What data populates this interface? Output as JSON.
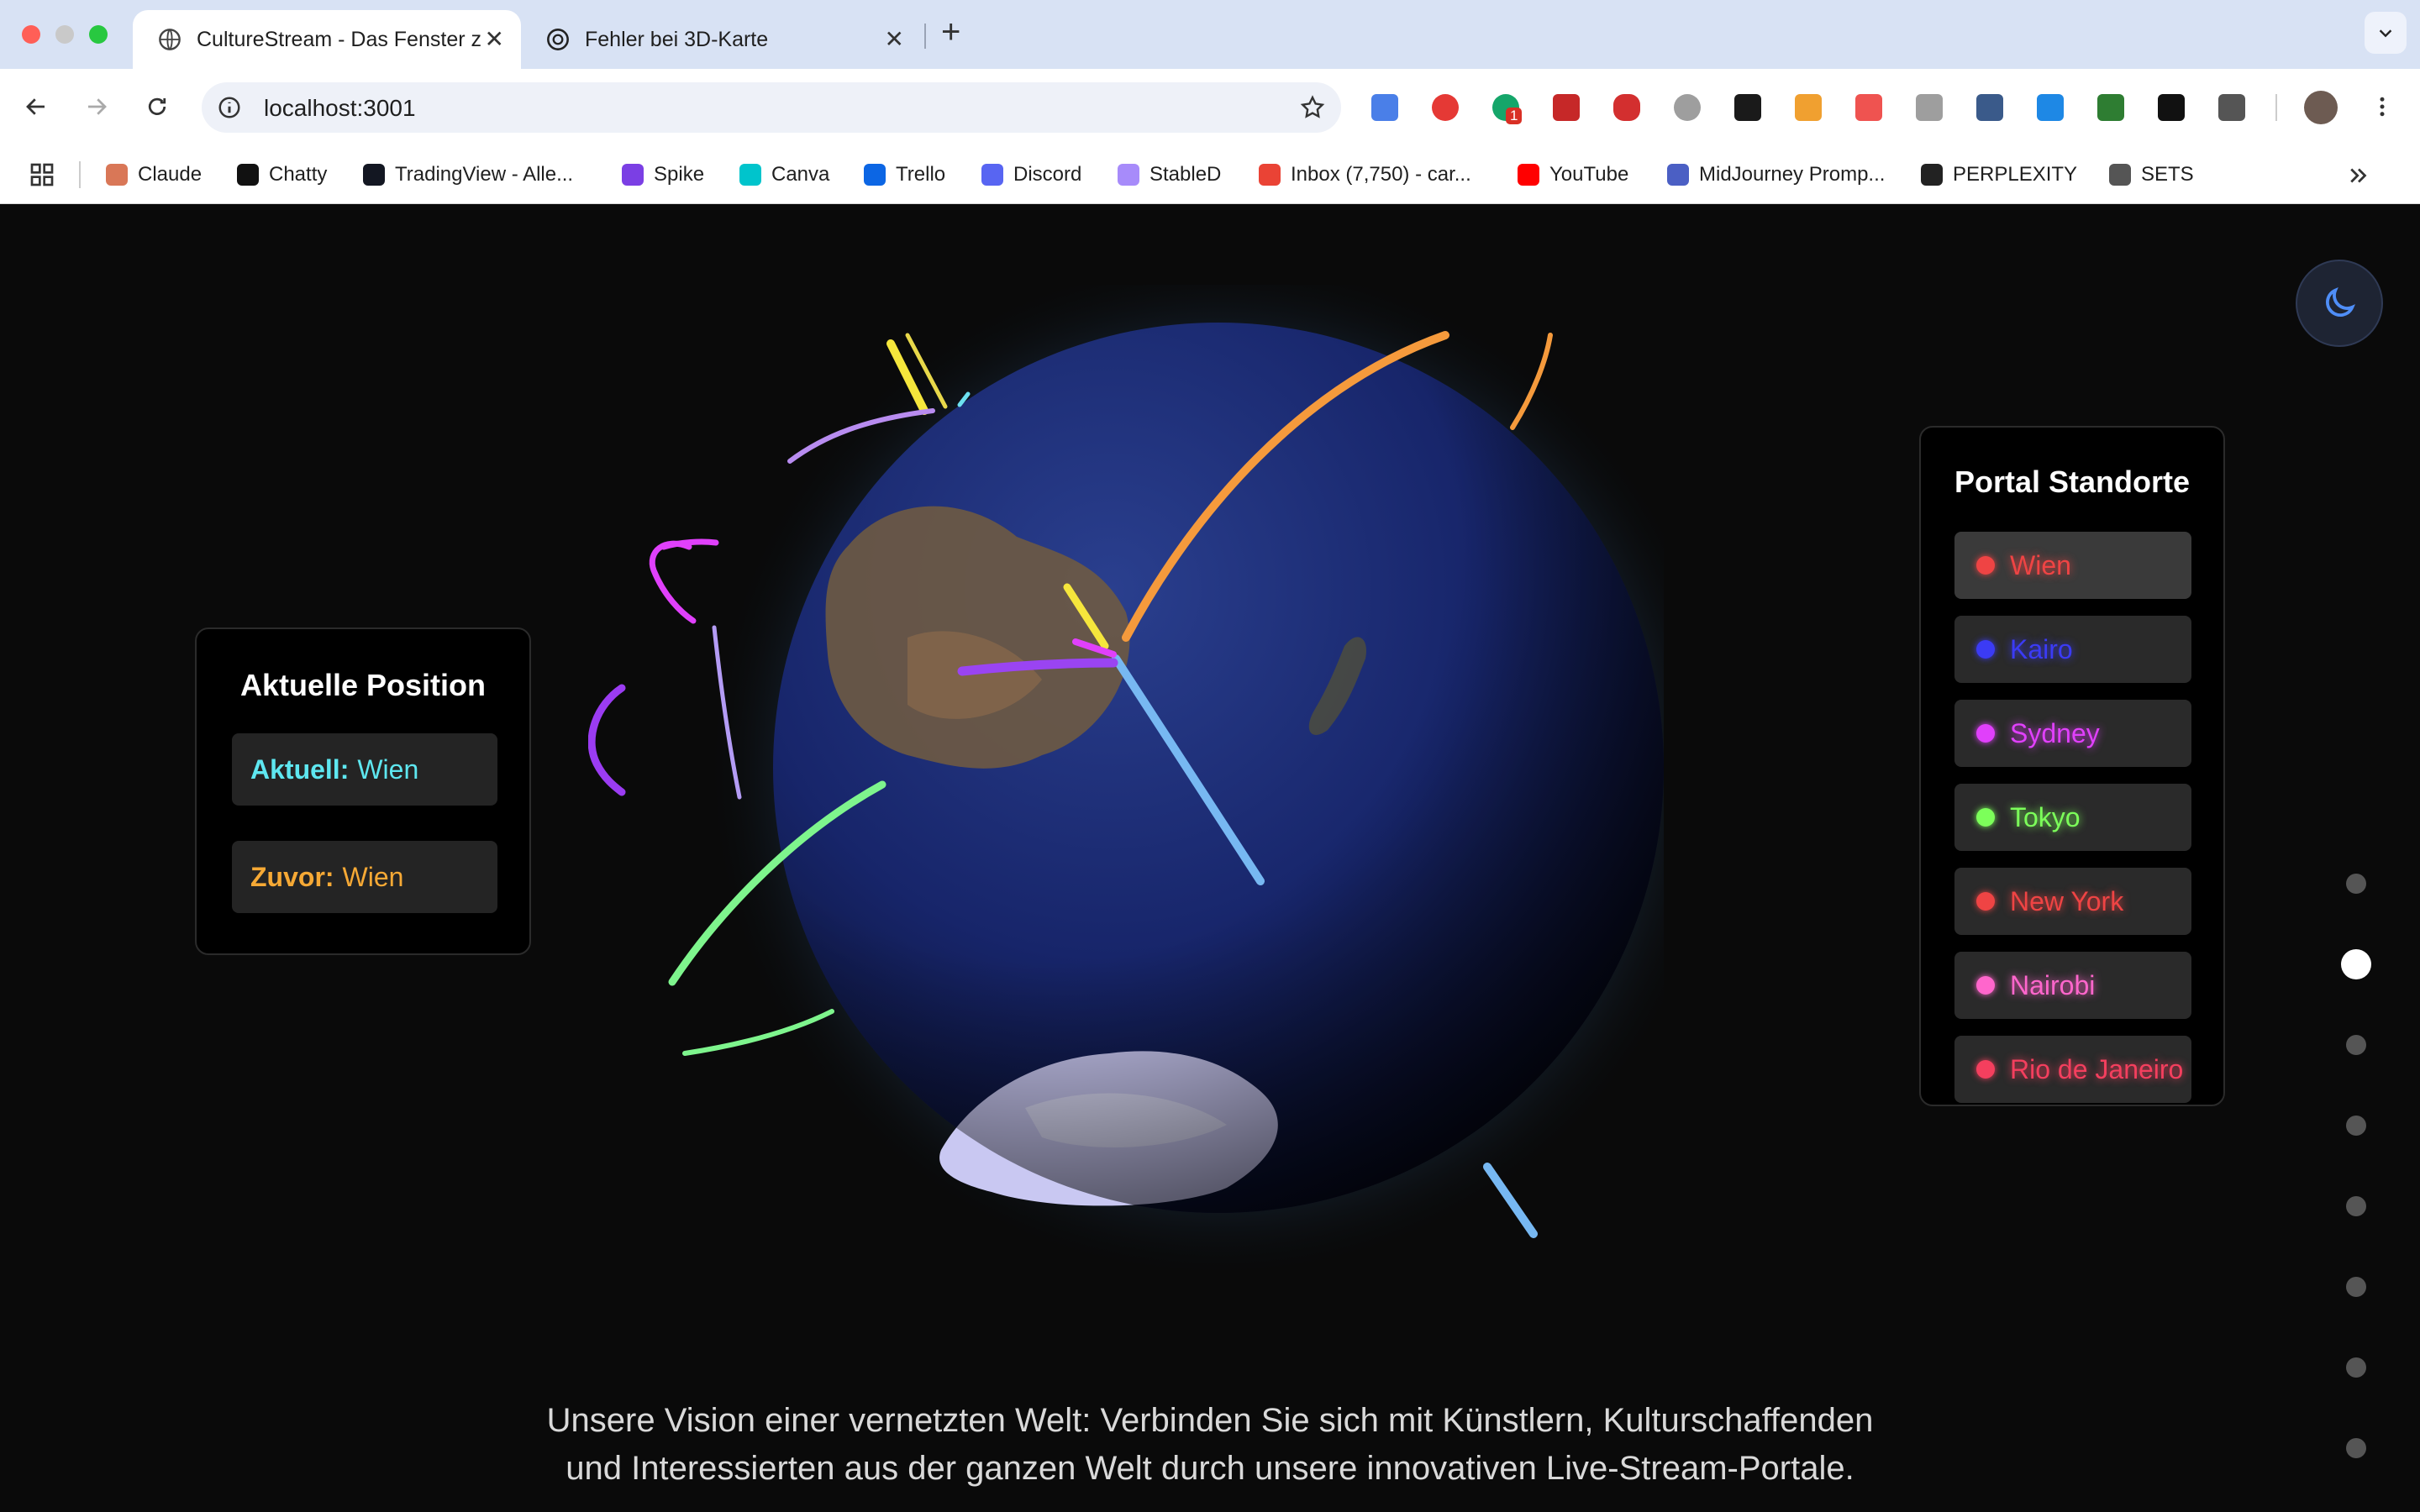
{
  "browser": {
    "tabs": [
      {
        "title": "CultureStream - Das Fenster z",
        "active": true
      },
      {
        "title": "Fehler bei 3D-Karte",
        "active": false
      }
    ],
    "url": "localhost:3001",
    "extension_badge": "1",
    "bookmarks": [
      {
        "label": "Claude",
        "color": "#d97757"
      },
      {
        "label": "Chatty",
        "color": "#111111"
      },
      {
        "label": "TradingView - Alle...",
        "color": "#131722"
      },
      {
        "label": "Spike",
        "color": "#7b3fe4"
      },
      {
        "label": "Canva",
        "color": "#00c4cc"
      },
      {
        "label": "Trello",
        "color": "#0c66e4"
      },
      {
        "label": "Discord",
        "color": "#5865f2"
      },
      {
        "label": "StableD",
        "color": "#a78bfa"
      },
      {
        "label": "Inbox (7,750) - car...",
        "color": "#ea4335"
      },
      {
        "label": "YouTube",
        "color": "#ff0000"
      },
      {
        "label": "MidJourney Promp...",
        "color": "#4b5fc4"
      },
      {
        "label": "PERPLEXITY",
        "color": "#222222"
      },
      {
        "label": "SETS",
        "color": "#555555"
      }
    ]
  },
  "position_panel": {
    "title": "Aktuelle Position",
    "current_label": "Aktuell:",
    "current_value": "Wien",
    "previous_label": "Zuvor:",
    "previous_value": "Wien"
  },
  "locations_panel": {
    "title": "Portal Standorte",
    "items": [
      {
        "name": "Wien",
        "color": "#ef4444",
        "active": true
      },
      {
        "name": "Kairo",
        "color": "#3b3bf5",
        "active": false
      },
      {
        "name": "Sydney",
        "color": "#e040fb",
        "active": false
      },
      {
        "name": "Tokyo",
        "color": "#7cff5a",
        "active": false
      },
      {
        "name": "New York",
        "color": "#ef4444",
        "active": false
      },
      {
        "name": "Nairobi",
        "color": "#ff66cc",
        "active": false
      },
      {
        "name": "Rio de Janeiro",
        "color": "#f43f5e",
        "active": false
      }
    ]
  },
  "pagination": {
    "count": 8,
    "active_index": 1
  },
  "vision_text": "Unsere Vision einer vernetzten Welt: Verbinden Sie sich mit Künstlern, Kulturschaffenden und Interessierten aus der ganzen Welt durch unsere innovativen Live-Stream-Portale."
}
